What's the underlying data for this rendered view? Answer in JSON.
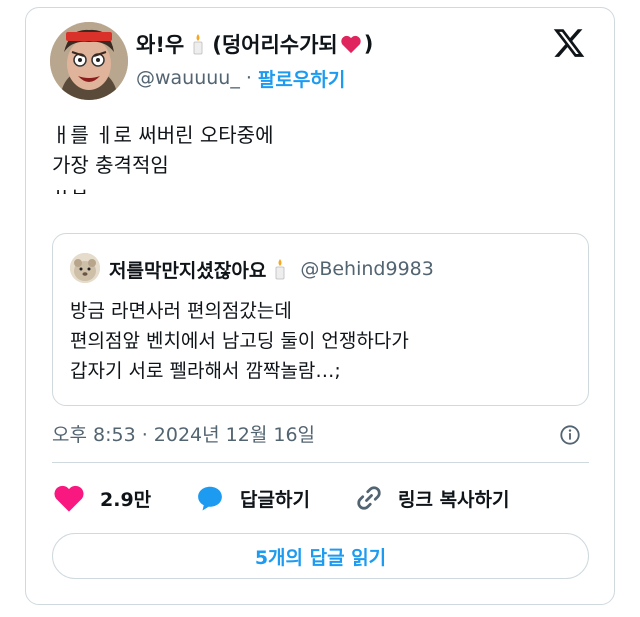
{
  "author": {
    "name_prefix": "와!우",
    "name_suffix": "(덩어리수가되",
    "name_close": ")",
    "handle": "@wauuuu_",
    "separator": "·",
    "follow_label": "팔로우하기"
  },
  "tweet": {
    "lines": [
      "ㅐ를 ㅔ로 써버린 오타중에",
      "가장 충격적임",
      "ㅆㅂ"
    ]
  },
  "quoted": {
    "name": "저를막만지셨잖아요",
    "handle": "@Behind9983",
    "lines": [
      "방금 라면사러 편의점갔는데",
      "편의점앞 벤치에서 남고딩 둘이 언쟁하다가",
      "갑자기 서로 펠라해서 깜짝놀람…;"
    ]
  },
  "meta": {
    "timestamp": "오후 8:53 · 2024년 12월 16일"
  },
  "actions": {
    "like_count": "2.9만",
    "reply_label": "답글하기",
    "copy_link_label": "링크 복사하기"
  },
  "read_replies_label": "5개의 답글 읽기",
  "colors": {
    "accent": "#1d9bf0",
    "like": "#f91880",
    "border": "#cfd9de",
    "secondary": "#536471"
  },
  "icons": [
    "candle-icon",
    "heart-icon",
    "x-logo-icon",
    "info-icon",
    "like-heart-icon",
    "reply-bubble-icon",
    "link-icon"
  ]
}
